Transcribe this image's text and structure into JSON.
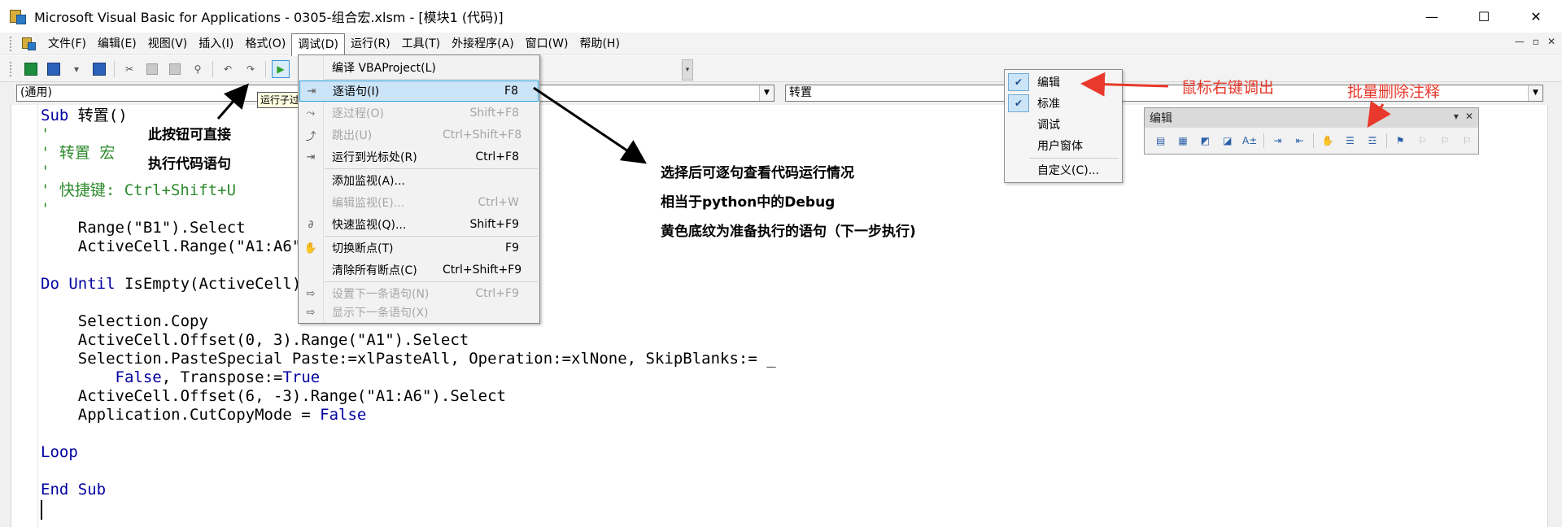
{
  "window": {
    "title": "Microsoft Visual Basic for Applications - 0305-组合宏.xlsm - [模块1 (代码)]",
    "minimize": "—",
    "maximize": "☐",
    "close": "✕"
  },
  "menubar": {
    "items": [
      {
        "label": "文件(F)"
      },
      {
        "label": "编辑(E)"
      },
      {
        "label": "视图(V)"
      },
      {
        "label": "插入(I)"
      },
      {
        "label": "格式(O)"
      },
      {
        "label": "调试(D)",
        "active": true
      },
      {
        "label": "运行(R)"
      },
      {
        "label": "工具(T)"
      },
      {
        "label": "外接程序(A)"
      },
      {
        "label": "窗口(W)"
      },
      {
        "label": "帮助(H)"
      }
    ],
    "doc_controls": [
      "—",
      "▫",
      "✕"
    ]
  },
  "combos": {
    "object": "(通用)",
    "procedure": "转置"
  },
  "tooltip": "运行子过程",
  "code": {
    "lines": [
      [
        {
          "t": "Sub",
          "c": "kw"
        },
        {
          "t": " 转置()",
          "c": "tx"
        }
      ],
      [
        {
          "t": "'",
          "c": "cm"
        }
      ],
      [
        {
          "t": "' 转置 宏",
          "c": "cm"
        }
      ],
      [
        {
          "t": "'",
          "c": "cm"
        }
      ],
      [
        {
          "t": "' 快捷键: Ctrl+Shift+U",
          "c": "cm"
        }
      ],
      [
        {
          "t": "'",
          "c": "cm"
        }
      ],
      [
        {
          "t": "    Range(\"B1\").Select",
          "c": "tx"
        }
      ],
      [
        {
          "t": "    ActiveCell.Range(\"A1:A6\").Select",
          "c": "tx"
        }
      ],
      [
        {
          "t": "",
          "c": "tx"
        }
      ],
      [
        {
          "t": "Do Until",
          "c": "kw"
        },
        {
          "t": " IsEmpty(ActiveCell)",
          "c": "tx"
        }
      ],
      [
        {
          "t": "",
          "c": "tx"
        }
      ],
      [
        {
          "t": "    Selection.Copy",
          "c": "tx"
        }
      ],
      [
        {
          "t": "    ActiveCell.Offset(0, 3).Range(\"A1\").Select",
          "c": "tx"
        }
      ],
      [
        {
          "t": "    Selection.PasteSpecial Paste:=xlPasteAll, Operation:=xlNone, SkipBlanks:= _",
          "c": "tx"
        }
      ],
      [
        {
          "t": "        ",
          "c": "tx"
        },
        {
          "t": "False",
          "c": "kw"
        },
        {
          "t": ", Transpose:=",
          "c": "tx"
        },
        {
          "t": "True",
          "c": "kw"
        }
      ],
      [
        {
          "t": "    ActiveCell.Offset(6, -3).Range(\"A1:A6\").Select",
          "c": "tx"
        }
      ],
      [
        {
          "t": "    Application.CutCopyMode = ",
          "c": "tx"
        },
        {
          "t": "False",
          "c": "kw"
        }
      ],
      [
        {
          "t": "",
          "c": "tx"
        }
      ],
      [
        {
          "t": "Loop",
          "c": "kw"
        }
      ],
      [
        {
          "t": "",
          "c": "tx"
        }
      ],
      [
        {
          "t": "End Sub",
          "c": "kw"
        }
      ]
    ]
  },
  "debug_menu": {
    "items": [
      {
        "label": "编译 VBAProject(L)",
        "shortcut": "",
        "disabled": false,
        "icon": ""
      },
      {
        "label": "逐语句(I)",
        "shortcut": "F8",
        "disabled": false,
        "highlight": true,
        "icon": "⇥"
      },
      {
        "label": "逐过程(O)",
        "shortcut": "Shift+F8",
        "disabled": true,
        "icon": "⤳"
      },
      {
        "label": "跳出(U)",
        "shortcut": "Ctrl+Shift+F8",
        "disabled": true,
        "icon": "⤴"
      },
      {
        "label": "运行到光标处(R)",
        "shortcut": "Ctrl+F8",
        "disabled": false,
        "icon": "⇥"
      },
      {
        "label": "添加监视(A)...",
        "shortcut": "",
        "disabled": false,
        "icon": ""
      },
      {
        "label": "编辑监视(E)...",
        "shortcut": "Ctrl+W",
        "disabled": true,
        "icon": ""
      },
      {
        "label": "快速监视(Q)...",
        "shortcut": "Shift+F9",
        "disabled": false,
        "icon": "∂"
      },
      {
        "label": "切换断点(T)",
        "shortcut": "F9",
        "disabled": false,
        "icon": "✋"
      },
      {
        "label": "清除所有断点(C)",
        "shortcut": "Ctrl+Shift+F9",
        "disabled": false,
        "icon": ""
      },
      {
        "label": "设置下一条语句(N)",
        "shortcut": "Ctrl+F9",
        "disabled": true,
        "icon": "⇨"
      },
      {
        "label": "显示下一条语句(X)",
        "shortcut": "",
        "disabled": true,
        "icon": "⇨"
      }
    ]
  },
  "context_menu": {
    "items": [
      {
        "label": "编辑",
        "checked": true
      },
      {
        "label": "标准",
        "checked": true
      },
      {
        "label": "调试",
        "checked": false
      },
      {
        "label": "用户窗体",
        "checked": false
      },
      {
        "label": "自定义(C)...",
        "checked": false
      }
    ]
  },
  "edit_toolbar": {
    "title": "编辑",
    "title_controls": [
      "▾",
      "✕"
    ]
  },
  "annotations": {
    "run_button_line1": "此按钮可直接",
    "run_button_line2": "执行代码语句",
    "step_line1": "选择后可逐句查看代码运行情况",
    "step_line2": "相当于python中的Debug",
    "step_line3": "黄色底纹为准备执行的语句（下一步执行)",
    "right_click": "鼠标右键调出",
    "batch_uncomment": "批量删除注释"
  },
  "colors": {
    "keyword": "#0000a0",
    "comment": "#2e8b2e",
    "annotation_red": "#e8392c",
    "menu_highlight": "#cce4f7"
  }
}
